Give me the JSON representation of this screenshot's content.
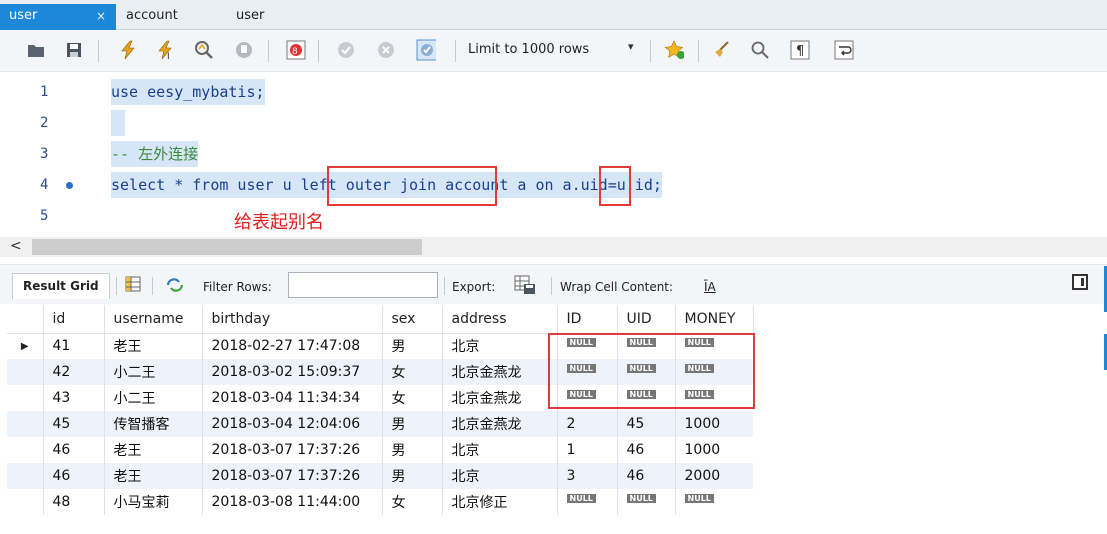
{
  "tabs": [
    {
      "label": "user",
      "active": true,
      "close": "×"
    },
    {
      "label": "account",
      "active": false
    },
    {
      "label": "user",
      "active": false
    }
  ],
  "toolbar": {
    "limit_select": "Limit to 1000 rows",
    "limit_arrow": "▾"
  },
  "editor": {
    "lines": [
      {
        "num": "1",
        "text": "use eesy_mybatis;"
      },
      {
        "num": "2",
        "text": " "
      },
      {
        "num": "3",
        "text": "-- 左外连接"
      },
      {
        "num": "4",
        "text": "select * from user u left outer join account a on a.uid=u.id;",
        "marker": true
      },
      {
        "num": "5",
        "text": ""
      }
    ],
    "annotation": "给表起别名"
  },
  "scrollbar": {
    "left_arrow": "<"
  },
  "results_toolbar": {
    "tab": "Result Grid",
    "filter_label": "Filter Rows:",
    "filter_value": "",
    "export_label": "Export:",
    "wrap_label": "Wrap Cell Content:",
    "wrap_icon": "ĪA"
  },
  "grid": {
    "columns": [
      "id",
      "username",
      "birthday",
      "sex",
      "address",
      "ID",
      "UID",
      "MONEY"
    ],
    "null_label": "NULL",
    "current_row_marker": "▶",
    "rows": [
      [
        "41",
        "老王",
        "2018-02-27 17:47:08",
        "男",
        "北京",
        null,
        null,
        null
      ],
      [
        "42",
        "小二王",
        "2018-03-02 15:09:37",
        "女",
        "北京金燕龙",
        null,
        null,
        null
      ],
      [
        "43",
        "小二王",
        "2018-03-04 11:34:34",
        "女",
        "北京金燕龙",
        null,
        null,
        null
      ],
      [
        "45",
        "传智播客",
        "2018-03-04 12:04:06",
        "男",
        "北京金燕龙",
        "2",
        "45",
        "1000"
      ],
      [
        "46",
        "老王",
        "2018-03-07 17:37:26",
        "男",
        "北京",
        "1",
        "46",
        "1000"
      ],
      [
        "46",
        "老王",
        "2018-03-07 17:37:26",
        "男",
        "北京",
        "3",
        "46",
        "2000"
      ],
      [
        "48",
        "小马宝莉",
        "2018-03-08 11:44:00",
        "女",
        "北京修正",
        null,
        null,
        null
      ]
    ]
  },
  "colors": {
    "accent": "#1e88d8",
    "highlight_box": "#e03a3a",
    "annotation": "#e02020",
    "selection": "#d7e6f7"
  }
}
